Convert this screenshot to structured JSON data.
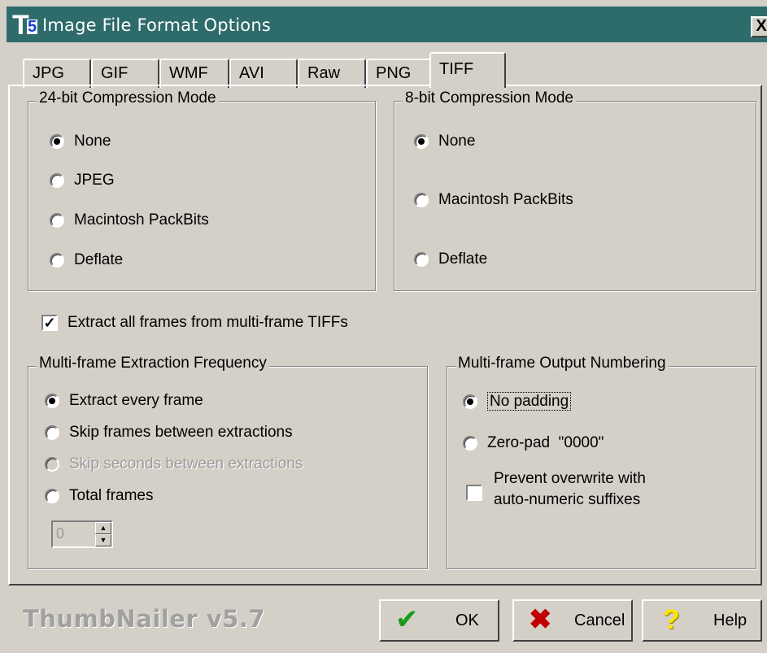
{
  "window": {
    "title": "Image File Format Options",
    "close_glyph": "X"
  },
  "tabs": [
    {
      "label": "JPG",
      "active": false
    },
    {
      "label": "GIF",
      "active": false
    },
    {
      "label": "WMF",
      "active": false
    },
    {
      "label": "AVI",
      "active": false
    },
    {
      "label": "Raw",
      "active": false
    },
    {
      "label": "PNG",
      "active": false
    },
    {
      "label": "TIFF",
      "active": true
    }
  ],
  "compression24": {
    "title": "24-bit Compression Mode",
    "options": [
      "None",
      "JPEG",
      "Macintosh PackBits",
      "Deflate"
    ],
    "selected": "None"
  },
  "compression8": {
    "title": "8-bit Compression Mode",
    "options": [
      "None",
      "Macintosh PackBits",
      "Deflate"
    ],
    "selected": "None"
  },
  "extract_all": {
    "label": "Extract all frames from multi-frame TIFFs",
    "checked": true
  },
  "frequency": {
    "title": "Multi-frame Extraction Frequency",
    "options": [
      "Extract every frame",
      "Skip frames between extractions",
      "Skip seconds between extractions",
      "Total frames"
    ],
    "selected": "Extract every frame",
    "disabled_option": "Skip seconds between extractions",
    "spinner_value": "0"
  },
  "numbering": {
    "title": "Multi-frame Output Numbering",
    "options": [
      "No padding",
      "Zero-pad  \"0000\""
    ],
    "selected": "No padding",
    "prevent_overwrite_line1": "Prevent overwrite with",
    "prevent_overwrite_line2": "auto-numeric suffixes",
    "prevent_overwrite_checked": false
  },
  "footer": {
    "brand": "ThumbNailer v5.7",
    "ok": "OK",
    "cancel": "Cancel",
    "help": "Help"
  },
  "colors": {
    "title_bar": "#2e6b6b",
    "ok_check": "#1a9a1a",
    "cancel_x": "#c00000",
    "help_icon": "#ffe600"
  }
}
